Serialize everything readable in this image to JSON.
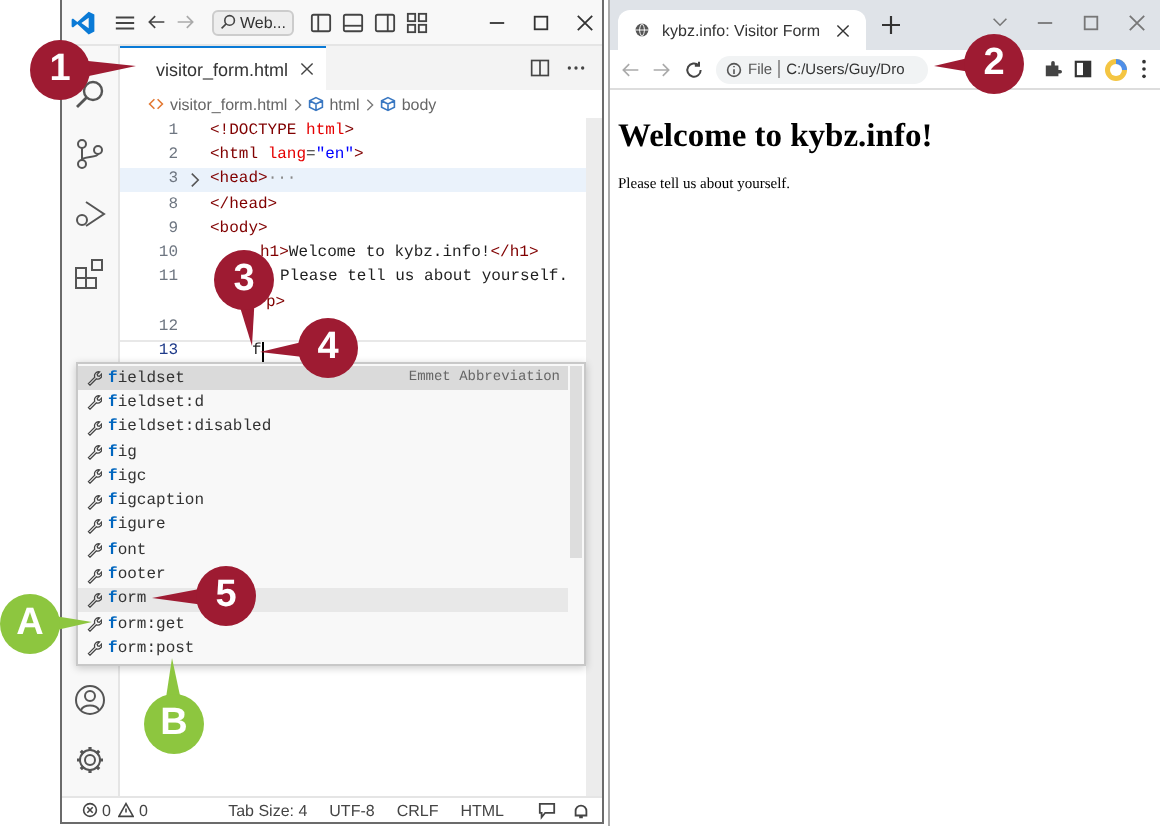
{
  "editor": {
    "command_center": "Web...",
    "tab": {
      "label": "visitor_form.html",
      "selected": true
    },
    "breadcrumbs": [
      "visitor_form.html",
      "html",
      "body"
    ],
    "lines": [
      {
        "number": "1",
        "kind": "code",
        "tokens": [
          {
            "text": "<!DOCTYPE ",
            "kind": "tag"
          },
          {
            "text": "html",
            "kind": "attr"
          },
          {
            "text": ">",
            "kind": "tag"
          }
        ]
      },
      {
        "number": "2",
        "kind": "code",
        "tokens": [
          {
            "text": "<html ",
            "kind": "tag"
          },
          {
            "text": "lang",
            "kind": "attr"
          },
          {
            "text": "=",
            "kind": "text"
          },
          {
            "text": "\"en\"",
            "kind": "string"
          },
          {
            "text": ">",
            "kind": "tag"
          }
        ]
      },
      {
        "number": "3",
        "kind": "code",
        "folded": true,
        "tokens": [
          {
            "text": "<head>",
            "kind": "tag"
          },
          {
            "text": "···",
            "kind": "ellipsis"
          }
        ]
      },
      {
        "number": "8",
        "kind": "code",
        "tokens": [
          {
            "text": "</head>",
            "kind": "tag"
          }
        ]
      },
      {
        "number": "9",
        "kind": "code",
        "tokens": [
          {
            "text": "<body>",
            "kind": "tag"
          }
        ]
      },
      {
        "number": "10",
        "kind": "inner",
        "tokens": [
          {
            "text": "h1>",
            "kind": "tag"
          },
          {
            "text": "Welcome to kybz.info!",
            "kind": "text"
          },
          {
            "text": "</h1>",
            "kind": "tag"
          }
        ]
      },
      {
        "number": "11",
        "kind": "para",
        "tokens": [
          {
            "text": "Please tell us about yourself.",
            "kind": "text"
          }
        ]
      },
      {
        "kind": "wrap",
        "tokens": [
          {
            "text": "p>",
            "kind": "tag"
          }
        ]
      },
      {
        "number": "12",
        "kind": "code"
      },
      {
        "number": "13",
        "kind": "cursor",
        "tokens": [
          {
            "text": "f",
            "kind": "text"
          }
        ]
      }
    ],
    "suggestions": [
      {
        "label": "**f**ieldset",
        "detail": "Emmet Abbreviation",
        "selected": true,
        "hovered": false
      },
      {
        "label": "**f**ieldset:d",
        "selected": false,
        "hovered": false
      },
      {
        "label": "**f**ieldset:disabled",
        "selected": false,
        "hovered": false
      },
      {
        "label": "**f**ig",
        "selected": false,
        "hovered": false
      },
      {
        "label": "**f**igc",
        "selected": false,
        "hovered": false
      },
      {
        "label": "**f**igcaption",
        "selected": false,
        "hovered": false
      },
      {
        "label": "**f**igure",
        "selected": false,
        "hovered": false
      },
      {
        "label": "**f**ont",
        "selected": false,
        "hovered": false
      },
      {
        "label": "**f**ooter",
        "selected": false,
        "hovered": false
      },
      {
        "label": "**f**orm",
        "selected": false,
        "hovered": true
      },
      {
        "label": "**f**orm:get",
        "selected": false,
        "hovered": false
      },
      {
        "label": "**f**orm:post",
        "selected": false,
        "hovered": false
      }
    ],
    "status_bar": {
      "errors": "0",
      "warnings": "0",
      "items": [
        "Tab Size: 4",
        "UTF-8",
        "CRLF",
        "HTML"
      ]
    }
  },
  "browser": {
    "tab": {
      "title": "kybz.info: Visitor Form",
      "selected": true
    },
    "address": {
      "scheme": "File",
      "path": "C:/Users/Guy/Dro"
    },
    "page": {
      "heading": "Welcome to kybz.info!",
      "paragraph": "Please tell us about yourself."
    }
  },
  "callouts": [
    {
      "label": "1",
      "color": "#9e1b32"
    },
    {
      "label": "2",
      "color": "#9e1b32"
    },
    {
      "label": "3",
      "color": "#9e1b32"
    },
    {
      "label": "4",
      "color": "#9e1b32"
    },
    {
      "label": "5",
      "color": "#9e1b32"
    },
    {
      "label": "A",
      "color": "#8dc63f"
    },
    {
      "label": "B",
      "color": "#8dc63f"
    }
  ]
}
